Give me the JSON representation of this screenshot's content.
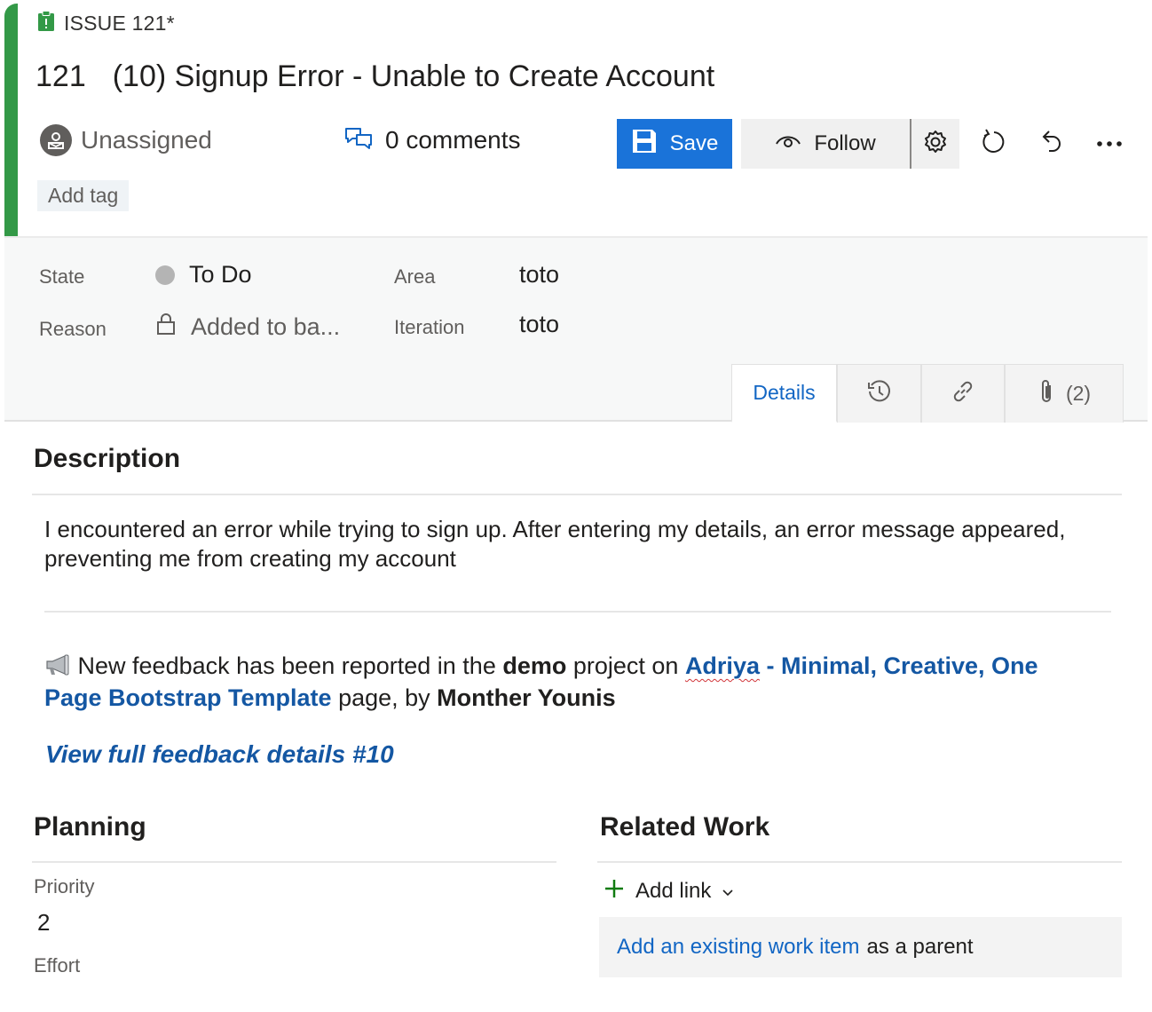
{
  "header": {
    "issue_label": "ISSUE 121*",
    "id": "121",
    "title": "(10) Signup Error - Unable to Create Account",
    "assignee": "Unassigned",
    "comments": "0 comments",
    "save_label": "Save",
    "follow_label": "Follow",
    "add_tag": "Add tag",
    "accent_color": "#339947"
  },
  "fields": {
    "state_label": "State",
    "state_value": "To Do",
    "reason_label": "Reason",
    "reason_value": "Added to ba...",
    "area_label": "Area",
    "area_value": "toto",
    "iteration_label": "Iteration",
    "iteration_value": "toto"
  },
  "tabs": {
    "details": "Details",
    "attachments_count": "(2)"
  },
  "description": {
    "title": "Description",
    "text": "I encountered an error while trying to sign up. After entering my details, an error message appeared, preventing me from creating my account",
    "feedback_prefix": "New feedback has been reported in the ",
    "project": "demo",
    "feedback_mid": " project on ",
    "page_link_part1": "Adriya",
    "page_link_part2": " - Minimal, Creative, One Page Bootstrap Template",
    "feedback_by": " page, by ",
    "author": "Monther Younis",
    "view_link": "View full feedback details #10"
  },
  "planning": {
    "title": "Planning",
    "priority_label": "Priority",
    "priority_value": "2",
    "effort_label": "Effort"
  },
  "related": {
    "title": "Related Work",
    "add_link": "Add link",
    "existing_link": "Add an existing work item",
    "existing_suffix": "as a parent"
  },
  "icons": [
    "clipboard-icon",
    "person-icon",
    "comments-icon",
    "save-icon",
    "eye-icon",
    "gear-icon",
    "refresh-icon",
    "undo-icon",
    "more-icon",
    "lock-icon",
    "history-icon",
    "link-icon",
    "paperclip-icon",
    "megaphone-icon",
    "plus-icon",
    "chevron-down-icon"
  ]
}
